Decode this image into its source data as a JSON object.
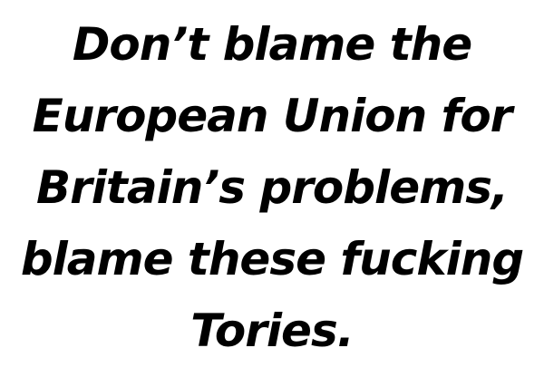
{
  "message": {
    "lines": [
      "Don’t blame the",
      "European Union for",
      "Britain’s problems,",
      "blame these fucking",
      "Tories."
    ]
  },
  "colors": {
    "background": "#ffffff",
    "text": "#000000"
  }
}
